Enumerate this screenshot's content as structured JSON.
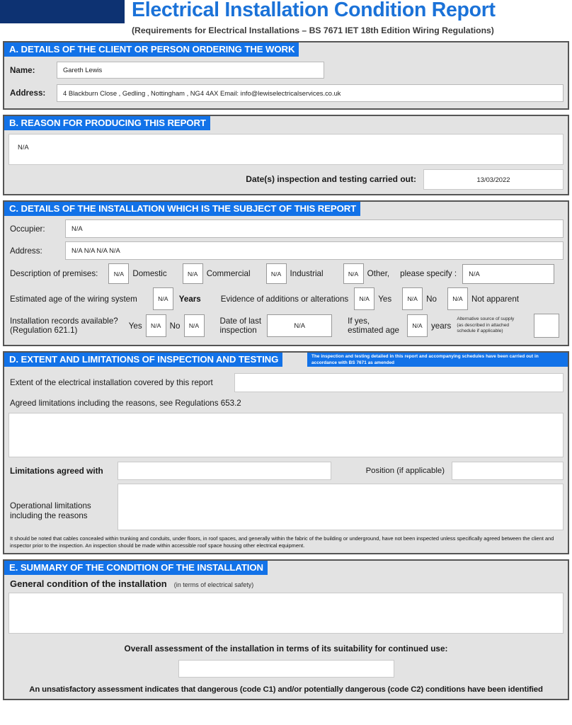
{
  "header": {
    "title": "Electrical Installation Condition Report",
    "subtitle": "(Requirements for Electrical Installations – BS 7671  IET 18th Edition Wiring Regulations)"
  },
  "section_a": {
    "heading": "A. DETAILS OF THE CLIENT OR PERSON ORDERING THE WORK",
    "name_label": "Name:",
    "name_value": "Gareth Lewis",
    "address_label": "Address:",
    "address_value": "4 Blackburn Close , Gedling , Nottingham , NG4 4AX        Email: info@lewiselectricalservices.co.uk"
  },
  "section_b": {
    "heading": "B. REASON FOR PRODUCING THIS REPORT",
    "reason_value": "N/A",
    "date_label": "Date(s) inspection and testing carried out:",
    "date_value": "13/03/2022"
  },
  "section_c": {
    "heading": "C. DETAILS OF THE INSTALLATION WHICH IS THE SUBJECT OF THIS REPORT",
    "occupier_label": "Occupier:",
    "occupier_value": "N/A",
    "address_label": "Address:",
    "address_value": "N/A  N/A  N/A  N/A",
    "premises_label": "Description of premises:",
    "premises_domestic_value": "N/A",
    "premises_domestic_label": "Domestic",
    "premises_commercial_value": "N/A",
    "premises_commercial_label": "Commercial",
    "premises_industrial_value": "N/A",
    "premises_industrial_label": "Industrial",
    "premises_other_value": "N/A",
    "premises_other_label": "Other,",
    "premises_specify_label": "please specify :",
    "premises_specify_value": "N/A",
    "age_label": "Estimated age of the wiring system",
    "age_value": "N/A",
    "age_units": "Years",
    "alterations_label": "Evidence of additions or alterations",
    "alterations_yes_value": "N/A",
    "alterations_yes_label": "Yes",
    "alterations_no_value": "N/A",
    "alterations_no_label": "No",
    "alterations_na_value": "N/A",
    "alterations_na_label": "Not apparent",
    "records_label_1": "Installation records available?",
    "records_label_2": "(Regulation 621.1)",
    "records_yes_label": "Yes",
    "records_yes_value": "N/A",
    "records_no_label": "No",
    "records_no_value": "N/A",
    "last_inspection_label_1": "Date of last",
    "last_inspection_label_2": "inspection",
    "last_inspection_value": "N/A",
    "if_yes_label_1": "If yes,",
    "if_yes_label_2": "estimated age",
    "if_yes_value": "N/A",
    "if_yes_units": "years",
    "alt_supply_line1": "Alternative source of supply",
    "alt_supply_line2": "(as described in attached",
    "alt_supply_line3": "schedule if applicable)",
    "alt_supply_value": ""
  },
  "section_d": {
    "heading": "D. EXTENT AND LIMITATIONS OF INSPECTION AND TESTING",
    "note": "The inspection and testing detailed in this report and accompanying schedules have been carried out in accordance with BS 7671 as amended",
    "extent_label": "Extent of the electrical installation covered by this report",
    "extent_value": "",
    "agreed_limitations_label": "Agreed limitations including the reasons, see Regulations 653.2",
    "agreed_limitations_value": "",
    "limitations_agreed_with_label": "Limitations agreed with",
    "limitations_agreed_with_value": "",
    "position_label": "Position (if applicable)",
    "position_value": "",
    "operational_label_1": "Operational limitations",
    "operational_label_2": "including the reasons",
    "operational_value": "",
    "footnote": "It should be noted that cables concealed within trunking and conduits, under floors, in roof spaces, and generally within the fabric of the building or underground, have not been inspected unless specifically agreed between the client and inspector prior to the inspection. An inspection should be made within accessible roof space housing other electrical equipment."
  },
  "section_e": {
    "heading": "E. SUMMARY OF THE CONDITION OF THE INSTALLATION",
    "general_condition_label": "General condition of the installation",
    "general_condition_hint": "(in terms of electrical safety)",
    "general_condition_value": "",
    "overall_label": "Overall assessment of the installation in terms of its suitability for continued use:",
    "overall_value": "",
    "warning": "An unsatisfactory assessment indicates that dangerous (code C1) and/or potentially dangerous (code C2) conditions have been identified"
  },
  "colors": {
    "header_bar_blue": "#1272e8",
    "title_blue": "#1b72d8",
    "logo_navy": "#0d3272",
    "section_bg": "#e3e3e3"
  }
}
